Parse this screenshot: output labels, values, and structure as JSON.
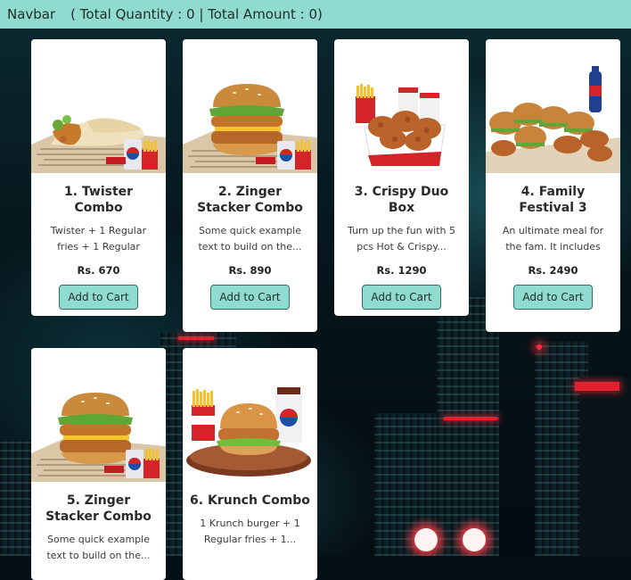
{
  "navbar": {
    "brand": "Navbar",
    "summary": "( Total Quantity : 0 | Total Amount : 0)"
  },
  "products": [
    {
      "title": "1. Twister Combo",
      "desc": "Twister + 1 Regular fries + 1 Regular drink",
      "price": "Rs. 670",
      "button": "Add to Cart",
      "image": "twister-wrap-with-pepsi-and-fries"
    },
    {
      "title": "2. Zinger Stacker Combo",
      "desc": "Some quick example text to build on the...",
      "price": "Rs. 890",
      "button": "Add to Cart",
      "image": "zinger-stacker-burger-with-pepsi-and-fries"
    },
    {
      "title": "3. Crispy Duo Box",
      "desc": "Turn up the fun with 5 pcs Hot & Crispy...",
      "price": "Rs. 1290",
      "button": "Add to Cart",
      "image": "fried-chicken-box-with-fries-and-drinks"
    },
    {
      "title": "4. Family Festival 3",
      "desc": "An ultimate meal for the fam. It includes 4...",
      "price": "Rs. 2490",
      "button": "Add to Cart",
      "image": "family-burgers-chicken-and-pepsi-bottle"
    },
    {
      "title": "5. Zinger Stacker Combo",
      "desc": "Some quick example text to build on the...",
      "price": "",
      "button": "",
      "image": "zinger-stacker-burger-with-pepsi-and-fries"
    },
    {
      "title": "6. Krunch Combo",
      "desc": "1 Krunch burger + 1 Regular fries + 1...",
      "price": "",
      "button": "",
      "image": "krunch-burger-with-fries-and-drink"
    }
  ],
  "colors": {
    "accent": "#90dbd0",
    "card": "#ffffff",
    "text": "#2a2a2a"
  }
}
